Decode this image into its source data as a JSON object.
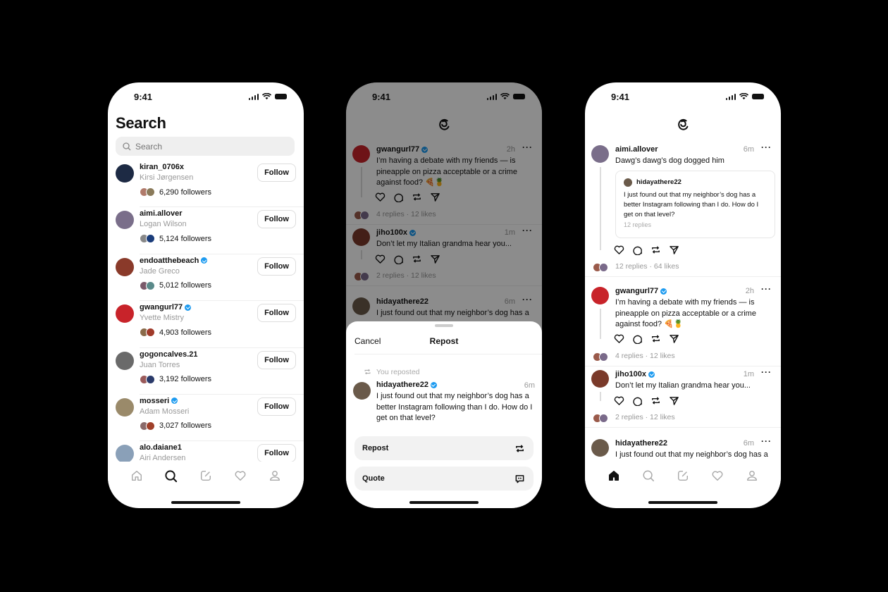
{
  "status_bar": {
    "time": "9:41"
  },
  "search_screen": {
    "title": "Search",
    "search_placeholder": "Search",
    "follow_label": "Follow",
    "users": [
      {
        "username": "kiran_0706x",
        "name": "Kirsi Jørgensen",
        "verified": false,
        "followers": "6,290 followers",
        "avatar_color": "#1d2a44",
        "mini": [
          "#b07a6a",
          "#8a7a5a"
        ]
      },
      {
        "username": "aimi.allover",
        "name": "Logan Wilson",
        "verified": false,
        "followers": "5,124 followers",
        "avatar_color": "#7a6e8a",
        "mini": [
          "#888888",
          "#1a3c7a"
        ]
      },
      {
        "username": "endoatthebeach",
        "name": "Jade Greco",
        "verified": true,
        "followers": "5,012 followers",
        "avatar_color": "#8a3a2a",
        "mini": [
          "#7a5a6a",
          "#5a8a8a"
        ]
      },
      {
        "username": "gwangurl77",
        "name": "Yvette Mistry",
        "verified": true,
        "followers": "4,903 followers",
        "avatar_color": "#c8232a",
        "mini": [
          "#8a6a4a",
          "#a03a2a"
        ]
      },
      {
        "username": "gogoncalves.21",
        "name": "Juan Torres",
        "verified": false,
        "followers": "3,192 followers",
        "avatar_color": "#6a6a6a",
        "mini": [
          "#9a5a5a",
          "#2a3a6a"
        ]
      },
      {
        "username": "mosseri",
        "name": "Adam Mosseri",
        "verified": true,
        "followers": "3,027 followers",
        "avatar_color": "#9a8a6a",
        "mini": [
          "#8a6a6a",
          "#a0402a"
        ]
      },
      {
        "username": "alo.daiane1",
        "name": "Airi Andersen",
        "verified": false,
        "followers": "",
        "avatar_color": "#8aa0b8",
        "mini": []
      }
    ]
  },
  "feed_dimmed": {
    "posts": [
      {
        "username": "gwangurl77",
        "verified": true,
        "time": "2h",
        "text": "I’m having a debate with my friends — is pineapple on pizza acceptable or a crime against food? 🍕🍍",
        "stats": "4 replies · 12 likes",
        "avatar_color": "#c8232a"
      },
      {
        "username": "jiho100x",
        "verified": true,
        "time": "1m",
        "text": "Don’t let my Italian grandma hear you...",
        "stats": "2 replies · 12 likes",
        "avatar_color": "#7a3a2a"
      },
      {
        "username": "hidayathere22",
        "verified": false,
        "time": "6m",
        "text": "I just found out that my neighbor’s dog has a",
        "stats": "",
        "avatar_color": "#6a5a4a"
      }
    ],
    "sheet": {
      "cancel_label": "Cancel",
      "title": "Repost",
      "reposted_label": "You reposted",
      "post": {
        "username": "hidayathere22",
        "verified": true,
        "time": "6m",
        "text": "I just found out that my neighbor’s dog has a better Instagram following than I do. How do I get on that level?"
      },
      "options": [
        {
          "label": "Repost",
          "icon": "repost-icon"
        },
        {
          "label": "Quote",
          "icon": "quote-icon"
        }
      ]
    }
  },
  "feed": {
    "posts": [
      {
        "username": "aimi.allover",
        "verified": false,
        "time": "6m",
        "text": "Dawg’s dawg’s dog dogged him",
        "stats": "12 replies · 64 likes",
        "avatar_color": "#7a6e8a",
        "quote": {
          "username": "hidayathere22",
          "text": "I just found out that my neighbor’s dog has a better Instagram following than I do. How do I get on that level?",
          "replies": "12 replies"
        }
      },
      {
        "username": "gwangurl77",
        "verified": true,
        "time": "2h",
        "text": "I’m having a debate with my friends — is pineapple on pizza acceptable or a crime against food? 🍕🍍",
        "stats": "4 replies · 12 likes",
        "avatar_color": "#c8232a"
      },
      {
        "username": "jiho100x",
        "verified": true,
        "time": "1m",
        "text": "Don’t let my Italian grandma hear you...",
        "stats": "2 replies · 12 likes",
        "avatar_color": "#7a3a2a"
      },
      {
        "username": "hidayathere22",
        "verified": false,
        "time": "6m",
        "text": "I just found out that my neighbor’s dog has a better Instagram following than I do. How do I",
        "stats": "",
        "avatar_color": "#6a5a4a"
      }
    ]
  },
  "tab_bar": {
    "tabs": [
      "home-icon",
      "search-icon",
      "compose-icon",
      "activity-heart-icon",
      "profile-icon"
    ]
  },
  "colors": {
    "verified": "#1d9bf0",
    "muted_text": "#999999",
    "background": "#000000"
  }
}
